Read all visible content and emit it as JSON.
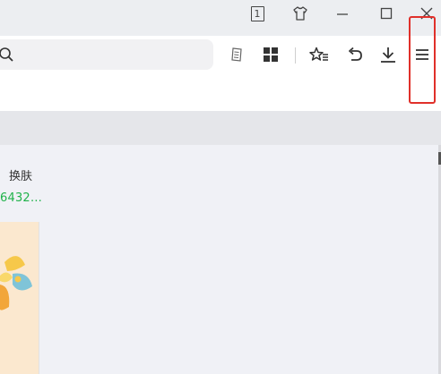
{
  "titlebar": {
    "tab_count": "1",
    "buttons": [
      "tab-count",
      "skin",
      "minimize",
      "maximize",
      "close"
    ]
  },
  "toolbar": {
    "search_placeholder": "",
    "icons": [
      "read-mode-icon",
      "apps-grid-icon",
      "favorites-icon",
      "undo-icon",
      "download-icon",
      "menu-icon"
    ]
  },
  "page": {
    "skin_label": "换肤",
    "green_text": "6432…"
  },
  "colors": {
    "highlight": "#e0302a",
    "green": "#20b24a"
  }
}
